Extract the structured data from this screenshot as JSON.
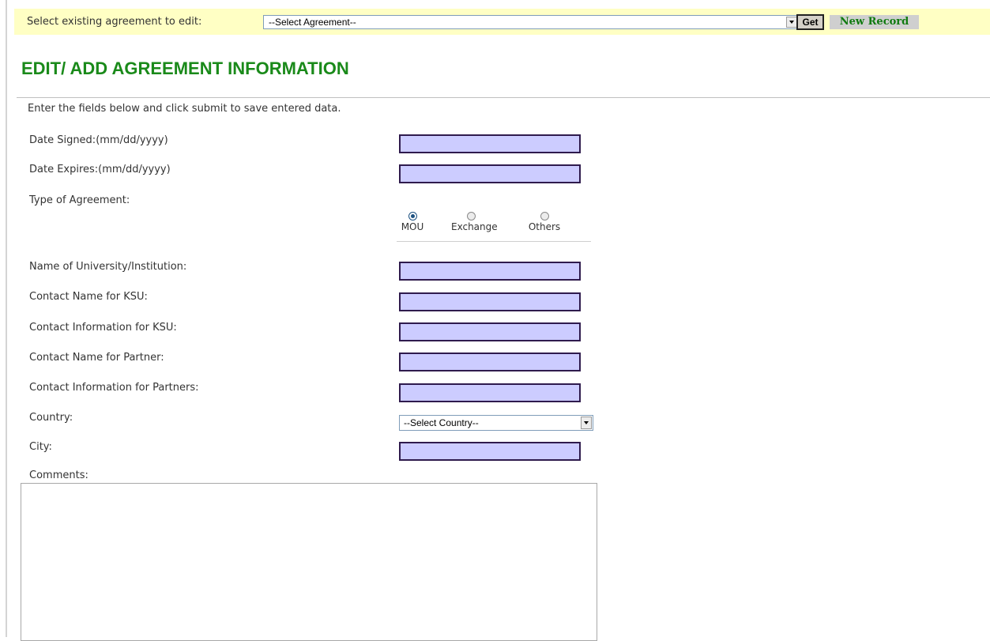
{
  "topbar": {
    "label": "Select existing agreement to edit:",
    "select_value": "--Select Agreement--",
    "get_label": "Get",
    "new_record_label": "New Record"
  },
  "page_title": "EDIT/ ADD AGREEMENT INFORMATION",
  "instructions": "Enter the fields below and click submit to save entered data.",
  "form": {
    "date_signed_label": "Date Signed:(mm/dd/yyyy)",
    "date_expires_label": "Date Expires:(mm/dd/yyyy)",
    "type_label": "Type of Agreement:",
    "type_options": [
      "MOU",
      "Exchange",
      "Others"
    ],
    "type_selected": "MOU",
    "university_label": "Name of University/Institution:",
    "contact_name_ksu_label": "Contact Name for KSU:",
    "contact_info_ksu_label": "Contact Information for KSU:",
    "contact_name_partner_label": "Contact Name for Partner:",
    "contact_info_partners_label": "Contact Information for Partners:",
    "country_label": "Country:",
    "country_value": "--Select Country--",
    "city_label": "City:",
    "comments_label": "Comments:"
  },
  "colors": {
    "topbar_bg": "#ffffc4",
    "title_green": "#1a8a1a",
    "input_fill": "#ccccff",
    "input_border": "#2f1b4d",
    "new_record_text": "#0f7a0f"
  }
}
